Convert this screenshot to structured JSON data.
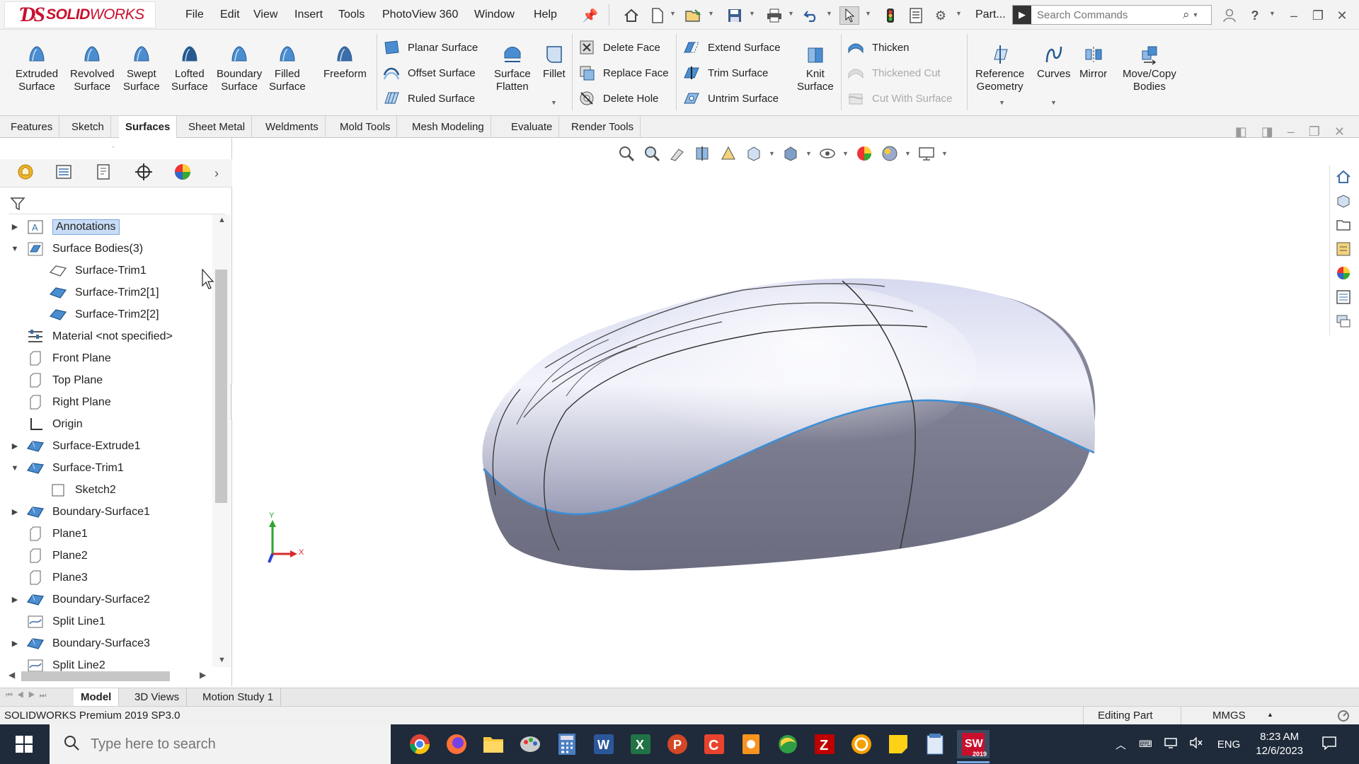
{
  "app": {
    "brand_prefix": "SOLID",
    "brand_suffix": "WORKS",
    "menu": [
      "File",
      "Edit",
      "View",
      "Insert",
      "Tools",
      "PhotoView 360",
      "Window",
      "Help"
    ],
    "doc_label": "Part...",
    "search_placeholder": "Search Commands",
    "accent_color": "#c8102e"
  },
  "ribbon": {
    "big_buttons": [
      {
        "label": "Extruded\nSurface",
        "icon": "extruded-surface-icon"
      },
      {
        "label": "Revolved\nSurface",
        "icon": "revolved-surface-icon"
      },
      {
        "label": "Swept\nSurface",
        "icon": "swept-surface-icon"
      },
      {
        "label": "Lofted\nSurface",
        "icon": "lofted-surface-icon"
      },
      {
        "label": "Boundary\nSurface",
        "icon": "boundary-surface-icon"
      },
      {
        "label": "Filled\nSurface",
        "icon": "filled-surface-icon"
      },
      {
        "label": "Freeform",
        "icon": "freeform-icon"
      }
    ],
    "col1": [
      "Planar Surface",
      "Offset Surface",
      "Ruled Surface"
    ],
    "surface_flatten": "Surface\nFlatten",
    "fillet": "Fillet",
    "col2": [
      "Delete Face",
      "Replace Face",
      "Delete Hole"
    ],
    "col3": [
      "Extend Surface",
      "Trim Surface",
      "Untrim Surface"
    ],
    "knit": "Knit\nSurface",
    "col4": [
      "Thicken",
      "Thickened Cut",
      "Cut With Surface"
    ],
    "ref_geometry": "Reference\nGeometry",
    "curves": "Curves",
    "mirror": "Mirror",
    "move_copy": "Move/Copy\nBodies"
  },
  "tabs": [
    "Features",
    "Sketch",
    "Surfaces",
    "Sheet Metal",
    "Weldments",
    "Mold Tools",
    "Mesh Modeling",
    "Evaluate",
    "Render Tools"
  ],
  "active_tab": "Surfaces",
  "tree": [
    {
      "label": "Annotations",
      "expander": "collapsed",
      "indent": 0,
      "icon": "annotations-icon",
      "selected": true
    },
    {
      "label": "Surface Bodies(3)",
      "expander": "expanded",
      "indent": 0,
      "icon": "surface-bodies-icon"
    },
    {
      "label": "Surface-Trim1",
      "expander": "none",
      "indent": 1,
      "icon": "surface-body-outline-icon"
    },
    {
      "label": "Surface-Trim2[1]",
      "expander": "none",
      "indent": 1,
      "icon": "surface-body-icon"
    },
    {
      "label": "Surface-Trim2[2]",
      "expander": "none",
      "indent": 1,
      "icon": "surface-body-icon"
    },
    {
      "label": "Material <not specified>",
      "expander": "none",
      "indent": 0,
      "icon": "material-icon"
    },
    {
      "label": "Front Plane",
      "expander": "none",
      "indent": 0,
      "icon": "plane-icon"
    },
    {
      "label": "Top Plane",
      "expander": "none",
      "indent": 0,
      "icon": "plane-icon"
    },
    {
      "label": "Right Plane",
      "expander": "none",
      "indent": 0,
      "icon": "plane-icon"
    },
    {
      "label": "Origin",
      "expander": "none",
      "indent": 0,
      "icon": "origin-icon"
    },
    {
      "label": "Surface-Extrude1",
      "expander": "collapsed",
      "indent": 0,
      "icon": "surface-feature-icon"
    },
    {
      "label": "Surface-Trim1",
      "expander": "expanded",
      "indent": 0,
      "icon": "surface-feature-icon"
    },
    {
      "label": "Sketch2",
      "expander": "none",
      "indent": 1,
      "icon": "sketch-icon"
    },
    {
      "label": "Boundary-Surface1",
      "expander": "collapsed",
      "indent": 0,
      "icon": "surface-feature-icon"
    },
    {
      "label": "Plane1",
      "expander": "none",
      "indent": 0,
      "icon": "plane-icon"
    },
    {
      "label": "Plane2",
      "expander": "none",
      "indent": 0,
      "icon": "plane-icon"
    },
    {
      "label": "Plane3",
      "expander": "none",
      "indent": 0,
      "icon": "plane-icon"
    },
    {
      "label": "Boundary-Surface2",
      "expander": "collapsed",
      "indent": 0,
      "icon": "surface-feature-icon"
    },
    {
      "label": "Split Line1",
      "expander": "none",
      "indent": 0,
      "icon": "split-line-icon"
    },
    {
      "label": "Boundary-Surface3",
      "expander": "collapsed",
      "indent": 0,
      "icon": "surface-feature-icon"
    },
    {
      "label": "Split Line2",
      "expander": "none",
      "indent": 0,
      "icon": "split-line-icon"
    }
  ],
  "triad": {
    "y": "Y",
    "x": "X"
  },
  "bottom_tabs": [
    "Model",
    "3D Views",
    "Motion Study 1"
  ],
  "active_bottom_tab": "Model",
  "status": {
    "product": "SOLIDWORKS Premium 2019 SP3.0",
    "mode": "Editing Part",
    "units": "MMGS"
  },
  "taskbar": {
    "search_placeholder": "Type here to search",
    "apps": [
      "chrome-icon",
      "firefox-icon",
      "file-explorer-icon",
      "paint-icon",
      "calculator-icon",
      "word-icon",
      "excel-icon",
      "powerpoint-icon",
      "app-c-icon",
      "app-orange-icon",
      "app-green-icon",
      "filezilla-icon",
      "app-e-icon",
      "sticky-notes-icon",
      "app-blue-icon",
      "solidworks-icon"
    ],
    "solidworks_year": "2019",
    "lang": "ENG",
    "time": "8:23 AM",
    "date": "12/6/2023"
  }
}
